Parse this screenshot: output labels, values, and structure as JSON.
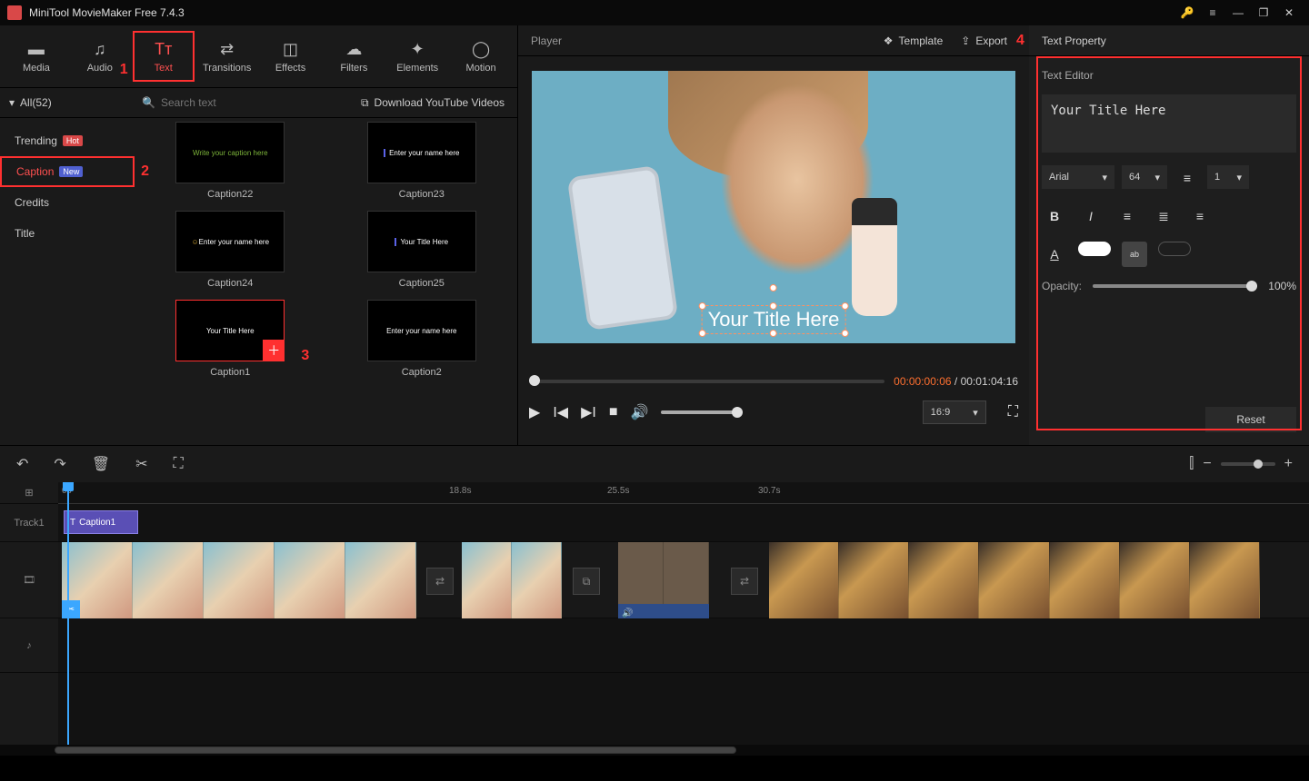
{
  "window": {
    "title": "MiniTool MovieMaker Free 7.4.3"
  },
  "toolbar": {
    "items": [
      {
        "label": "Media",
        "glyph": "📁"
      },
      {
        "label": "Audio",
        "glyph": "♪"
      },
      {
        "label": "Text",
        "glyph": "Tᴛ",
        "selected": true
      },
      {
        "label": "Transitions",
        "glyph": "⇄"
      },
      {
        "label": "Effects",
        "glyph": "◫"
      },
      {
        "label": "Filters",
        "glyph": "●"
      },
      {
        "label": "Elements",
        "glyph": "✦"
      },
      {
        "label": "Motion",
        "glyph": "◯"
      }
    ]
  },
  "filter": {
    "all_label": "All(52)",
    "search_placeholder": "Search text",
    "download_label": "Download YouTube Videos"
  },
  "categories": [
    {
      "label": "Trending",
      "badge": "Hot"
    },
    {
      "label": "Caption",
      "badge": "New",
      "selected": true
    },
    {
      "label": "Credits"
    },
    {
      "label": "Title"
    }
  ],
  "thumbs": [
    {
      "label": "Caption22",
      "preview": "Write your caption here"
    },
    {
      "label": "Caption23",
      "preview": "Enter your name here"
    },
    {
      "label": "Caption24",
      "preview": "Enter your name here"
    },
    {
      "label": "Caption25",
      "preview": "Your Title Here"
    },
    {
      "label": "Caption1",
      "preview": "Your  Title  Here",
      "selected": true
    },
    {
      "label": "Caption2",
      "preview": "Enter your name here"
    }
  ],
  "annotations": {
    "n1": "1",
    "n2": "2",
    "n3": "3",
    "n4": "4"
  },
  "player": {
    "label": "Player",
    "template": "Template",
    "export": "Export",
    "overlay_text": "Your Title Here",
    "time_current": "00:00:00:06",
    "time_total": "00:01:04:16",
    "time_sep": " / ",
    "aspect": "16:9"
  },
  "props": {
    "title": "Text Property",
    "editor_label": "Text Editor",
    "text_value": "Your Title Here",
    "font": "Arial",
    "size": "64",
    "lineheight": "1",
    "opacity_label": "Opacity:",
    "opacity_value": "100%",
    "reset": "Reset"
  },
  "timeline": {
    "ruler": [
      "0s",
      "18.8s",
      "25.5s",
      "30.7s"
    ],
    "track_label": "Track1",
    "caption_clip": "Caption1"
  }
}
